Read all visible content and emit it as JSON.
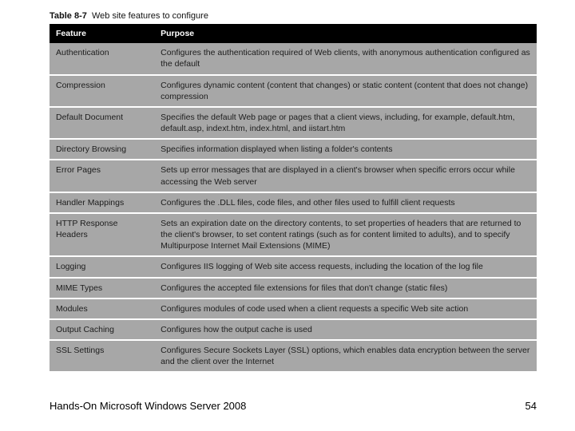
{
  "caption": {
    "label": "Table 8-7",
    "text": "Web site features to configure"
  },
  "headers": {
    "feature": "Feature",
    "purpose": "Purpose"
  },
  "rows": [
    {
      "feature": "Authentication",
      "purpose": "Configures the authentication required of Web clients, with anonymous authentication configured as the default"
    },
    {
      "feature": "Compression",
      "purpose": "Configures dynamic content (content that changes) or static content (content that does not change) compression"
    },
    {
      "feature": "Default Document",
      "purpose": "Specifies the default Web page or pages that a client views, including, for example, default.htm, default.asp, indext.htm, index.html, and iistart.htm"
    },
    {
      "feature": "Directory Browsing",
      "purpose": "Specifies information displayed when listing a folder's contents"
    },
    {
      "feature": "Error Pages",
      "purpose": "Sets up error messages that are displayed in a client's browser when specific errors occur while accessing the Web server"
    },
    {
      "feature": "Handler Mappings",
      "purpose": "Configures the .DLL files, code files, and other files used to fulfill client requests"
    },
    {
      "feature": "HTTP Response Headers",
      "purpose": "Sets an expiration date on the directory contents, to set properties of headers that are returned to the client's browser, to set content ratings (such as for content limited to adults), and to specify Multipurpose Internet Mail Extensions (MIME)"
    },
    {
      "feature": "Logging",
      "purpose": "Configures IIS logging of Web site access requests, including the location of the log file"
    },
    {
      "feature": "MIME Types",
      "purpose": "Configures the accepted file extensions for files that don't change (static files)"
    },
    {
      "feature": "Modules",
      "purpose": "Configures modules of code used when a client requests a specific Web site action"
    },
    {
      "feature": "Output Caching",
      "purpose": "Configures how the output cache is used"
    },
    {
      "feature": "SSL Settings",
      "purpose": "Configures Secure Sockets Layer (SSL) options, which enables data encryption between the server and the client over the Internet"
    }
  ],
  "footer": {
    "title": "Hands-On Microsoft Windows Server 2008",
    "page": "54"
  }
}
